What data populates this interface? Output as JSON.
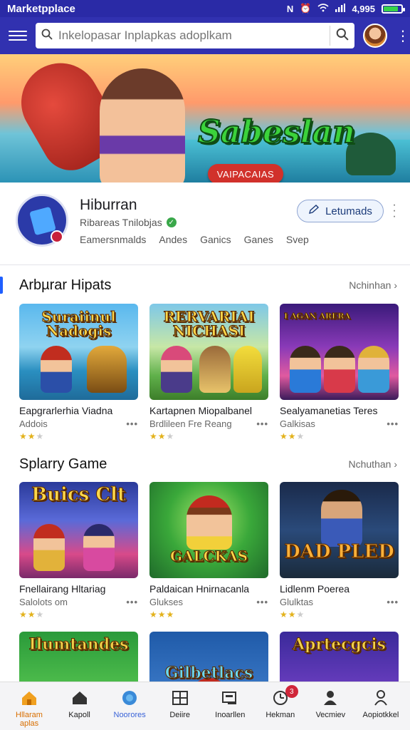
{
  "status_bar": {
    "title": "Marketpplace",
    "time": "4,995",
    "battery_level": 0.85
  },
  "search": {
    "placeholder": "Inkelopasar Inplapkas adoplkam"
  },
  "banner": {
    "title": "Sabeslan",
    "cta_label": "VAIPACAIAS"
  },
  "profile": {
    "name": "Hiburran",
    "subtitle": "Ribareas Tnilobjas",
    "follow_label": "Letumads",
    "categories": [
      "Eamersnmalds",
      "Andes",
      "Ganics",
      "Ganes",
      "Svep"
    ]
  },
  "sections": [
    {
      "title": "Arbµrar Hipats",
      "more_label": "Nchinhan",
      "cards": [
        {
          "thumb_title": "Suraiinul Nadogis",
          "title": "Eapgrarlerhia Viadna",
          "subtitle": "Addois",
          "stars": 2
        },
        {
          "thumb_title": "RERVARIAI NICHASI",
          "title": "Kartapnen Miopalbanel",
          "subtitle": "Brdlileen Fre Reang",
          "stars": 2
        },
        {
          "thumb_title": "I AGAN ARERA",
          "title": "Sealyamanetias Teres",
          "subtitle": "Galkisas",
          "stars": 2
        }
      ]
    },
    {
      "title": "Splarry Game",
      "more_label": "Nchuthan",
      "cards": [
        {
          "thumb_title": "Buics Clt",
          "title": "Fnellairang Hltariag",
          "subtitle": "Salolots om",
          "stars": 2
        },
        {
          "thumb_title": "GALCKAS",
          "title": "Paldaican Hnirnacanla",
          "subtitle": "Glukses",
          "stars": 3
        },
        {
          "thumb_title": "DAD PLED",
          "title": "Lidlenm Poerea",
          "subtitle": "Glulktas",
          "stars": 2
        }
      ]
    },
    {
      "cards": [
        {
          "thumb_title": "Ilumtandes"
        },
        {
          "thumb_title": "Gilbetlacs"
        },
        {
          "thumb_title": "Aprtecgcis"
        }
      ]
    }
  ],
  "bottom_nav": [
    {
      "label": "Hllaram aplas",
      "icon": "house-icon"
    },
    {
      "label": "Kapoll",
      "icon": "home-icon"
    },
    {
      "label": "Noorores",
      "icon": "globe-icon"
    },
    {
      "label": "Deiire",
      "icon": "grid-icon"
    },
    {
      "label": "Inoarllen",
      "icon": "card-icon"
    },
    {
      "label": "Hekman",
      "icon": "clock-icon",
      "badge": "3"
    },
    {
      "label": "Vecmiev",
      "icon": "person-icon"
    },
    {
      "label": "Aopiotkkel",
      "icon": "user-outline-icon"
    }
  ],
  "colors": {
    "status_bar": "#2a2aa6",
    "top_bar": "#3131b0",
    "accent": "#1f5fff",
    "star": "#e3b21c",
    "nav_active": "#d86e00"
  }
}
